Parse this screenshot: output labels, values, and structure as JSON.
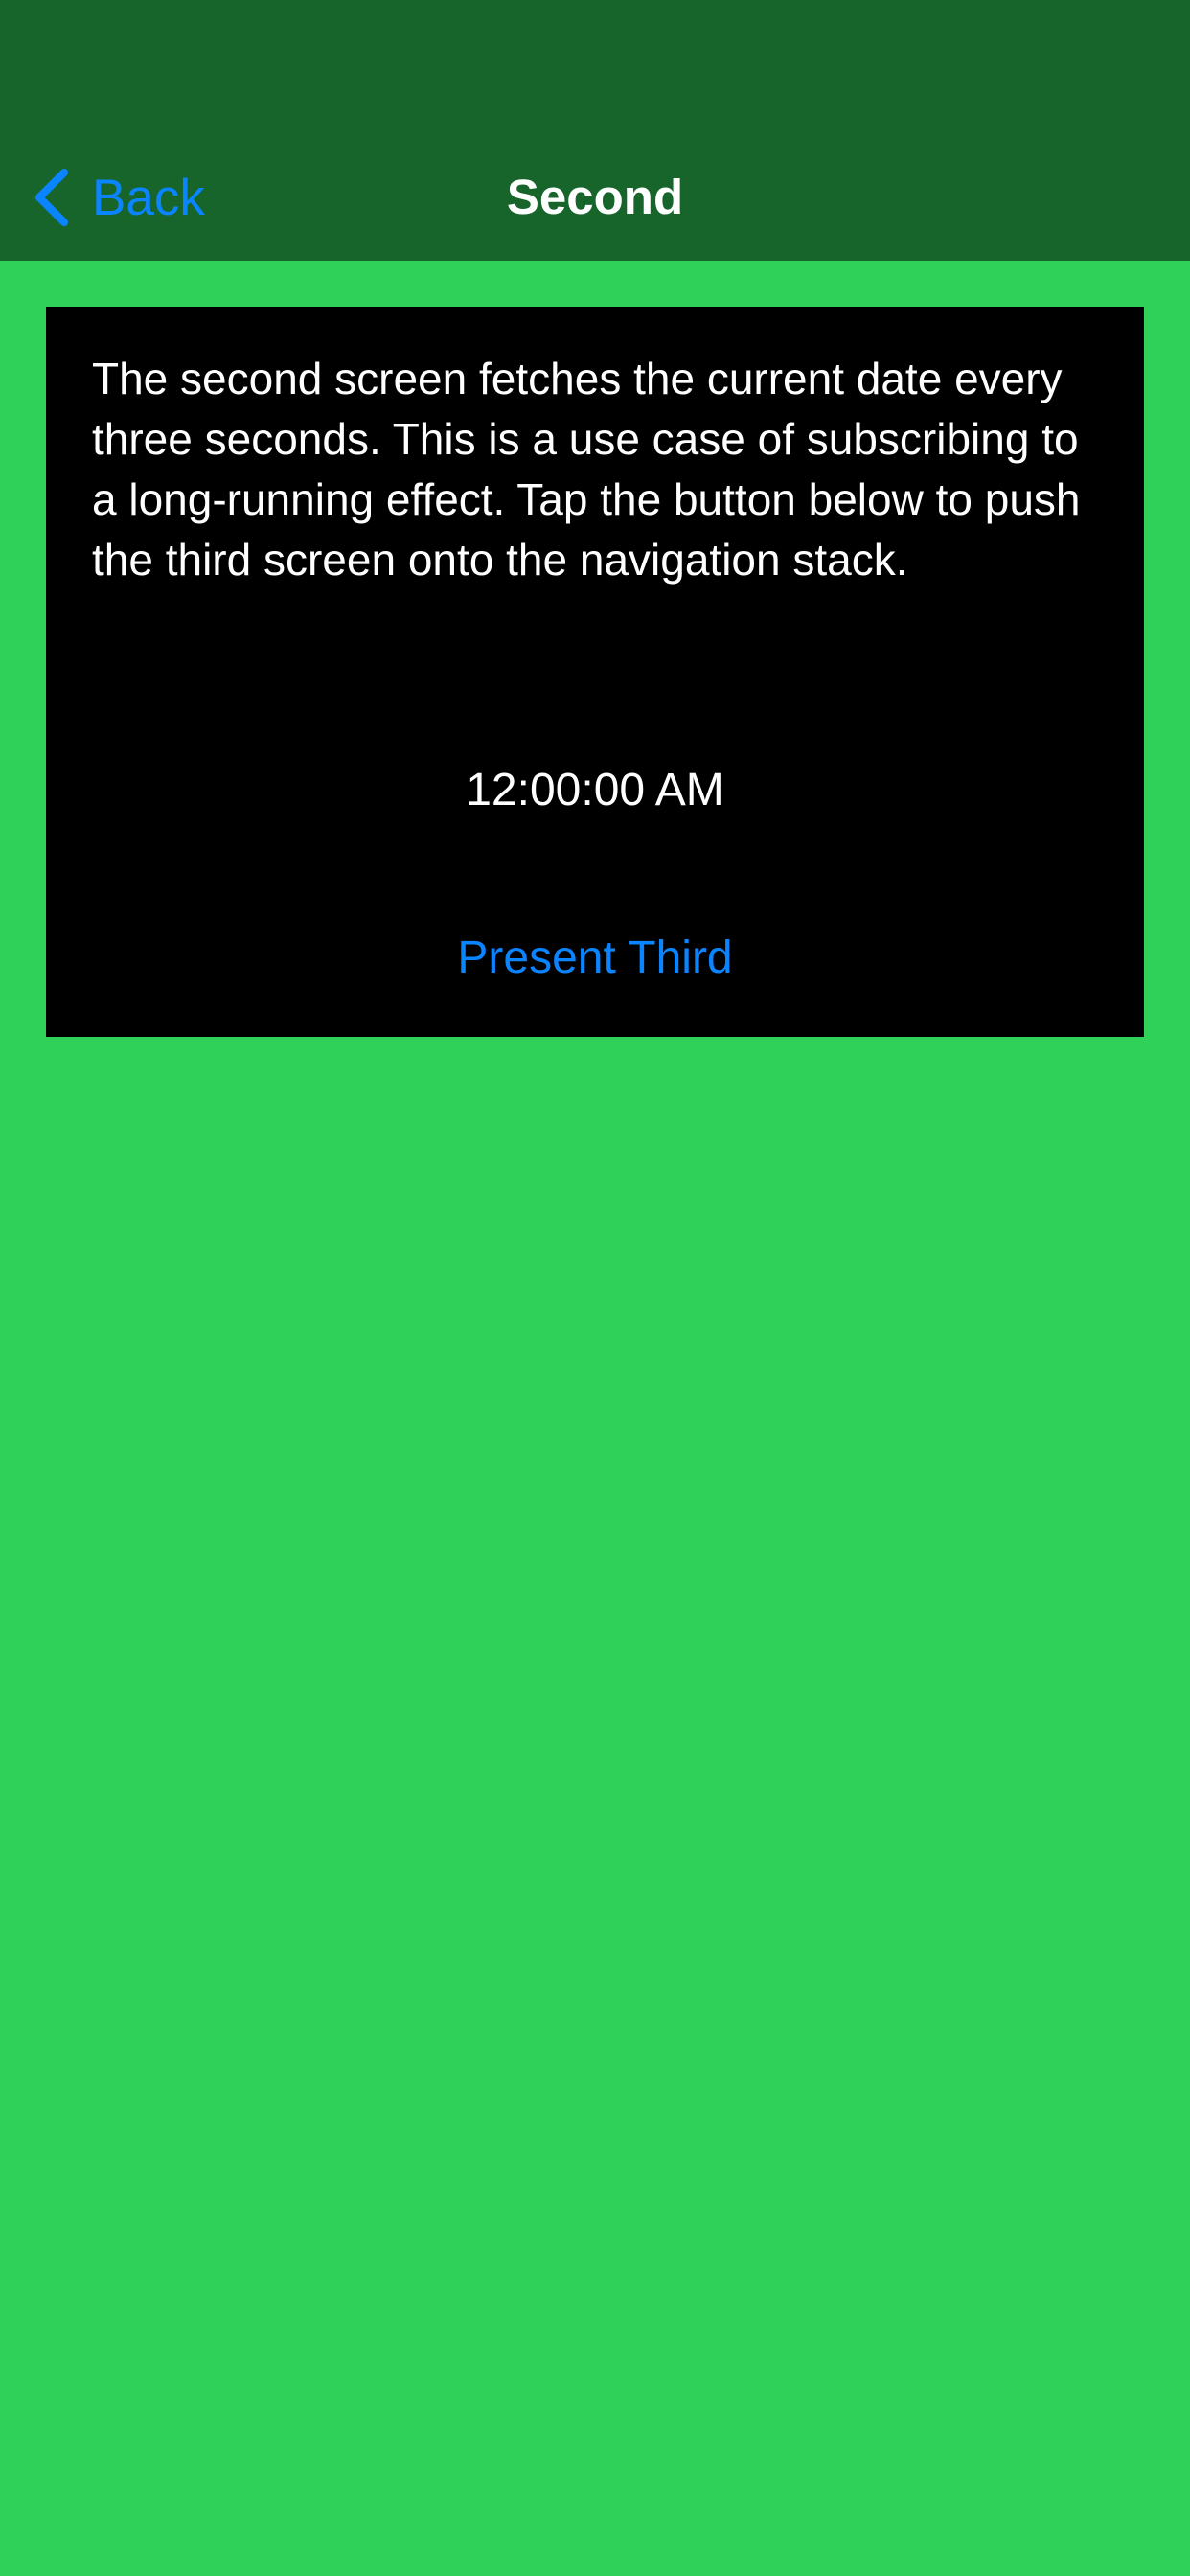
{
  "nav": {
    "back_label": "Back",
    "back_icon": "chevron-left-icon",
    "title": "Second"
  },
  "content": {
    "description": "The second screen fetches the current date every three seconds. This is a use case of subscribing to a long-running effect. Tap the button below to push the third screen onto the navigation stack.",
    "time": "12:00:00 AM",
    "present_button_label": "Present Third"
  },
  "colors": {
    "background": "#30d158",
    "nav_bar": "#17652b",
    "card": "#000000",
    "accent": "#0a84ff",
    "text": "#ffffff"
  }
}
